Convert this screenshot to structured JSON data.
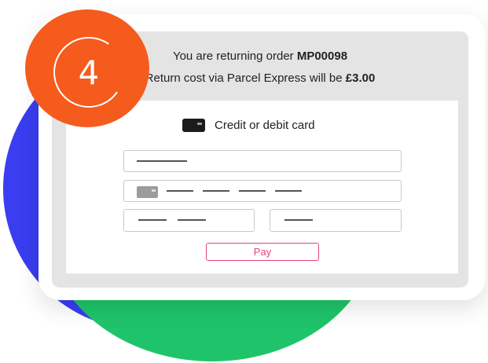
{
  "step": {
    "number": "4"
  },
  "header": {
    "line1_prefix": "You are returning order ",
    "order_id": "MP00098",
    "line2_prefix": "Return cost via Parcel Express will be ",
    "cost": "£3.00"
  },
  "payment": {
    "method_label": "Credit or debit card",
    "method_icon": "credit-card-icon",
    "pay_label": "Pay",
    "accent_color": "#e2457a"
  },
  "colors": {
    "badge": "#f55b1d",
    "blob_blue": "#3a3df0",
    "blob_green": "#1fc46a"
  }
}
